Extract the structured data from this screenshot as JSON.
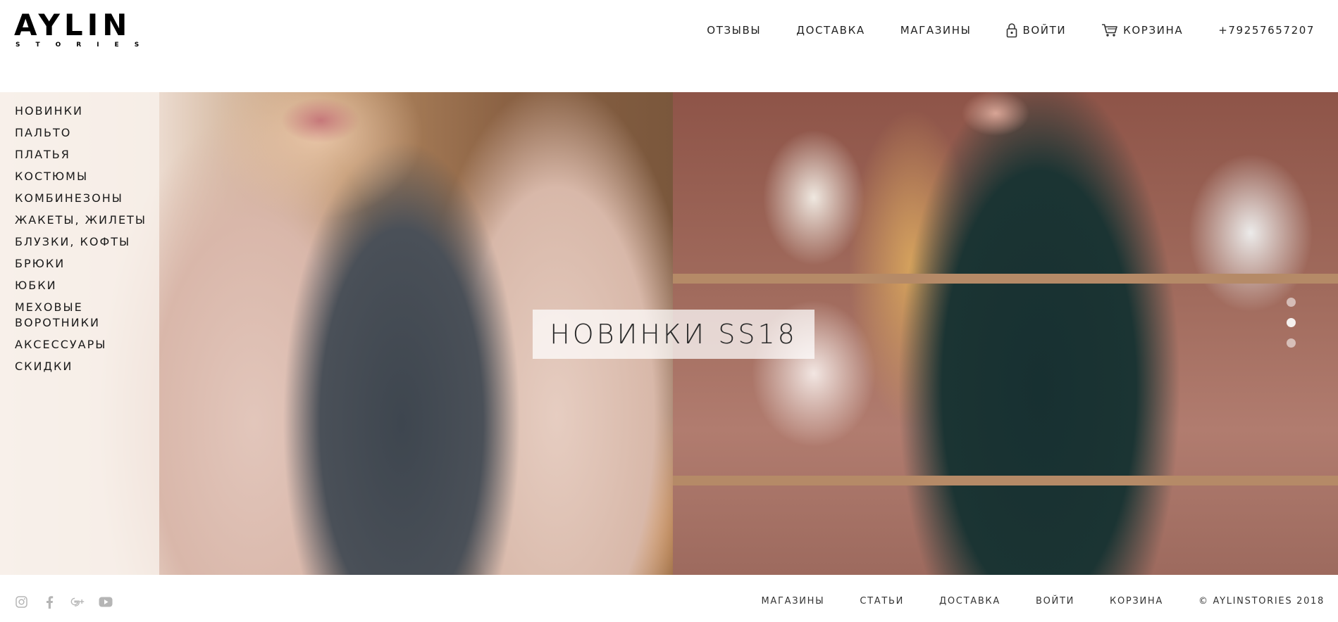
{
  "brand": {
    "logo_main": "AYLIN",
    "logo_sub": "STORIES"
  },
  "top_nav": {
    "reviews": "ОТЗЫВЫ",
    "delivery": "ДОСТАВКА",
    "stores": "МАГАЗИНЫ",
    "login": "ВОЙТИ",
    "cart": "КОРЗИНА",
    "phone": "+79257657207"
  },
  "sidebar": {
    "items": [
      "НОВИНКИ",
      "ПАЛЬТО",
      "ПЛАТЬЯ",
      "КОСТЮМЫ",
      "КОМБИНЕЗОНЫ",
      "ЖАКЕТЫ, ЖИЛЕТЫ",
      "БЛУЗКИ, КОФТЫ",
      "БРЮКИ",
      "ЮБКИ",
      "МЕХОВЫЕ ВОРОТНИКИ",
      "АКСЕССУАРЫ",
      "СКИДКИ"
    ]
  },
  "hero": {
    "title": "НОВИНКИ SS18",
    "slides_total": 3,
    "active_slide": 2
  },
  "footer": {
    "social_icons": [
      "instagram-icon",
      "facebook-icon",
      "google-plus-icon",
      "youtube-icon"
    ],
    "links": {
      "stores": "МАГАЗИНЫ",
      "articles": "СТАТЬИ",
      "delivery": "ДОСТАВКА",
      "login": "ВОЙТИ",
      "cart": "КОРЗИНА"
    },
    "copyright": "© AYLINSTORIES 2018"
  }
}
